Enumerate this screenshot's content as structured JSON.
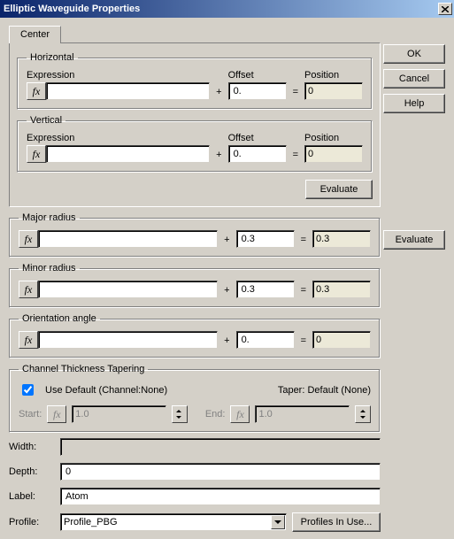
{
  "title": "Elliptic Waveguide Properties",
  "buttons": {
    "ok": "OK",
    "cancel": "Cancel",
    "help": "Help",
    "evaluate": "Evaluate",
    "profiles_in_use": "Profiles In Use..."
  },
  "tabs": {
    "center": "Center"
  },
  "center": {
    "horizontal": {
      "legend": "Horizontal",
      "expression_label": "Expression",
      "expression": "",
      "offset_label": "Offset",
      "offset": "0.",
      "position_label": "Position",
      "position": "0"
    },
    "vertical": {
      "legend": "Vertical",
      "expression_label": "Expression",
      "expression": "",
      "offset_label": "Offset",
      "offset": "0.",
      "position_label": "Position",
      "position": "0"
    }
  },
  "major_radius": {
    "legend": "Major radius",
    "expression": "",
    "offset": "0.3",
    "result": "0.3"
  },
  "minor_radius": {
    "legend": "Minor radius",
    "expression": "",
    "offset": "0.3",
    "result": "0.3"
  },
  "orientation_angle": {
    "legend": "Orientation angle",
    "expression": "",
    "offset": "0.",
    "result": "0"
  },
  "channel_tapering": {
    "legend": "Channel Thickness Tapering",
    "use_default_label": "Use Default  (Channel:None)",
    "taper_label": "Taper: Default (None)",
    "start_label": "Start:",
    "start": "1.0",
    "end_label": "End:",
    "end": "1.0"
  },
  "fields": {
    "width_label": "Width:",
    "width": "",
    "depth_label": "Depth:",
    "depth": "0",
    "label_label": "Label:",
    "label": "Atom",
    "profile_label": "Profile:",
    "profile": "Profile_PBG"
  },
  "ops": {
    "plus": "+",
    "equals": "="
  },
  "fx": "fx"
}
